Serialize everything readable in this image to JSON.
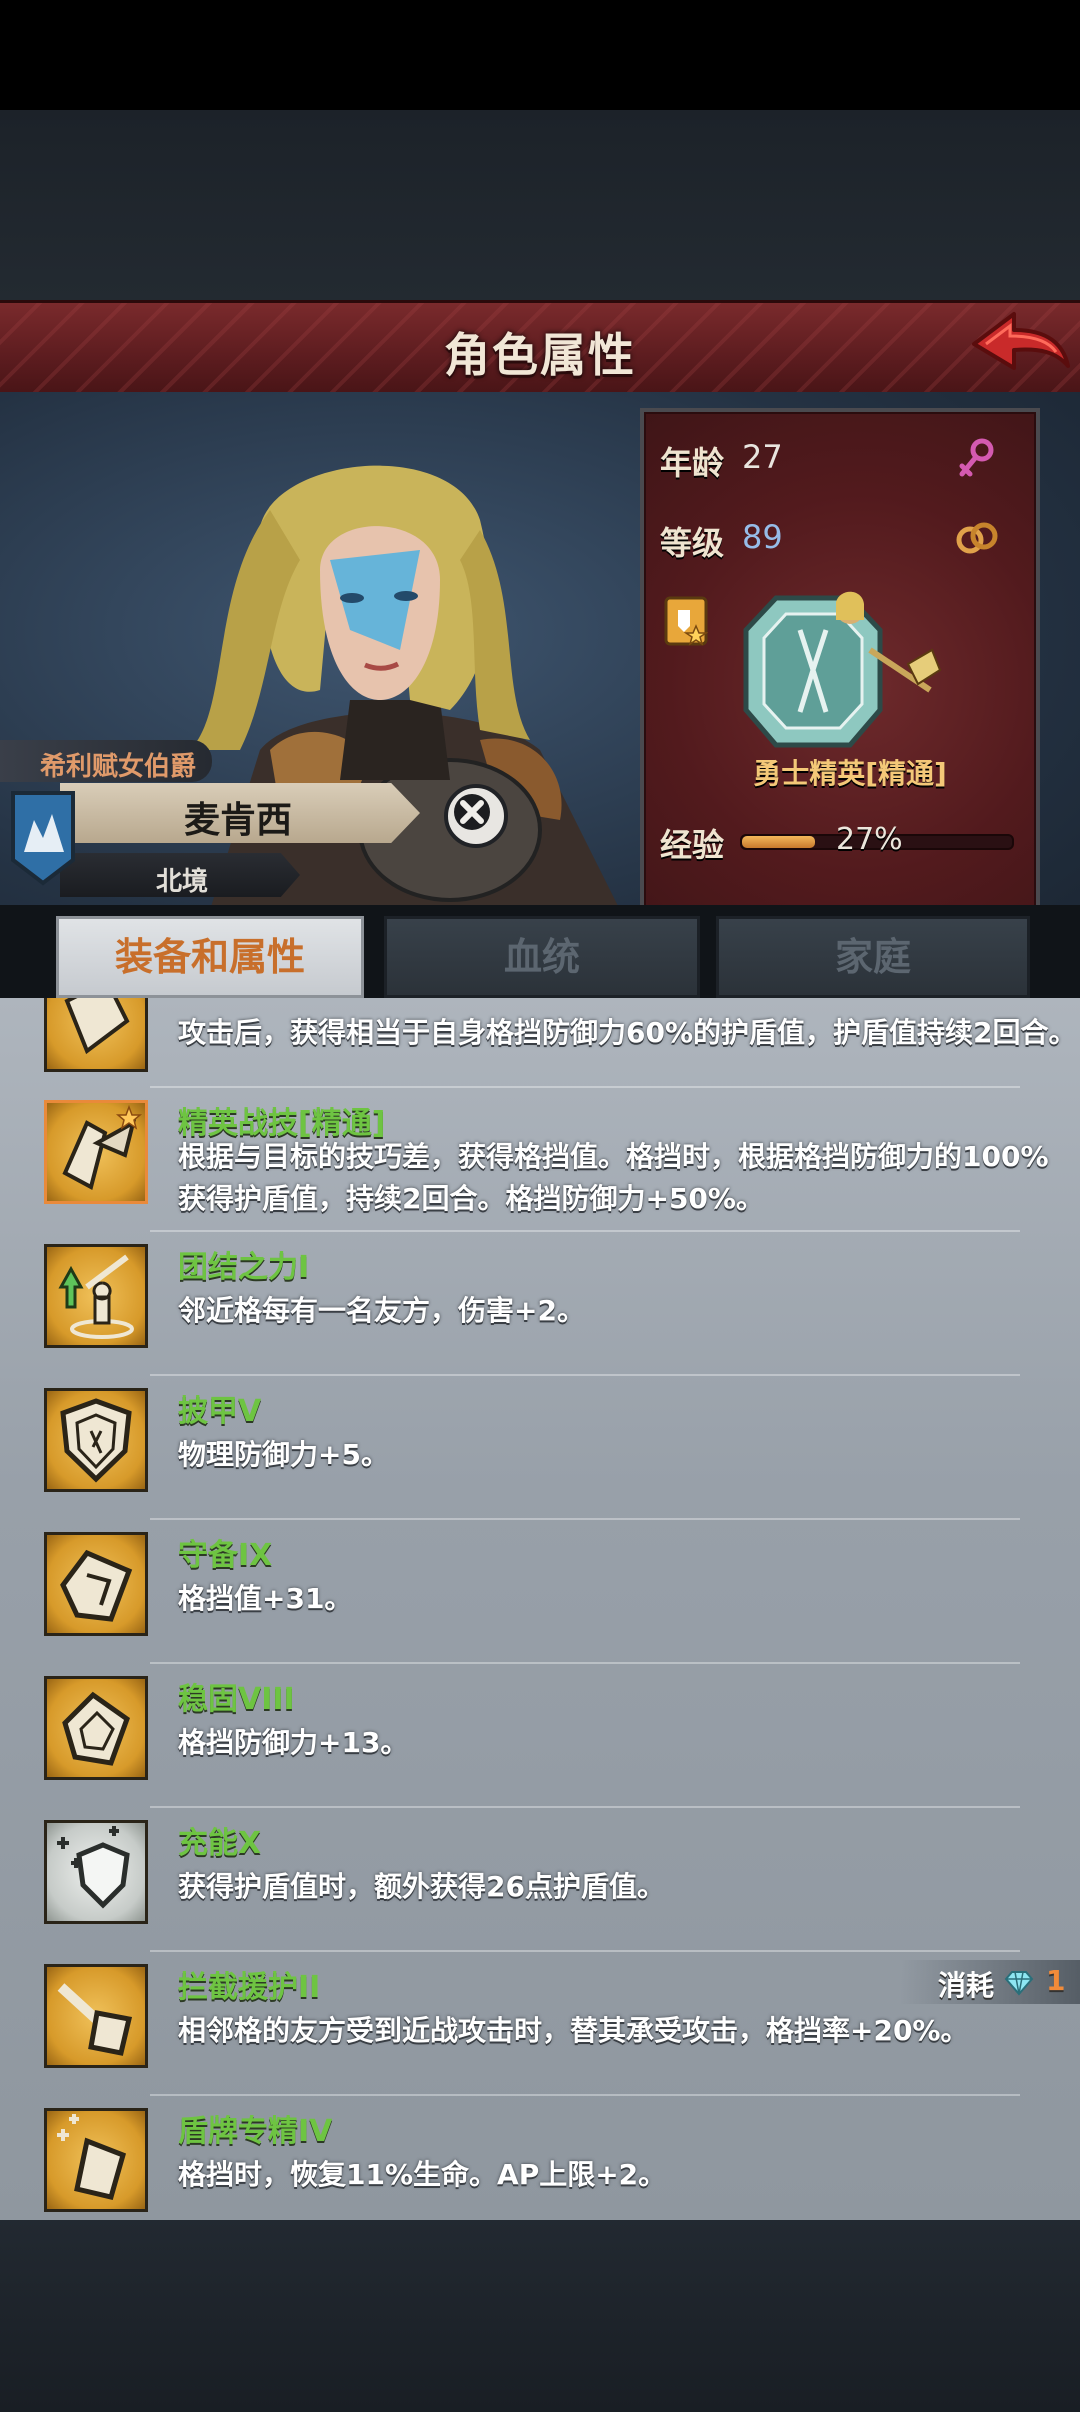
{
  "header": {
    "title": "角色属性"
  },
  "character": {
    "title": "希利赋女伯爵",
    "name": "麦肯西",
    "region": "北境"
  },
  "stats": {
    "age_label": "年龄",
    "age": "27",
    "level_label": "等级",
    "level": "89",
    "class_name": "勇士精英[精通]",
    "xp_label": "经验",
    "xp_percent": "27%",
    "xp_fraction": 0.27
  },
  "tabs": [
    {
      "label": "装备和属性",
      "active": true
    },
    {
      "label": "血统",
      "active": false
    },
    {
      "label": "家庭",
      "active": false
    }
  ],
  "skills": [
    {
      "name": "",
      "desc": [
        "攻击后，获得相当于自身格挡防御力60%的护盾值，护盾值持续2回合。"
      ],
      "icon": "shield-bash-icon"
    },
    {
      "name": "精英战技[精通]",
      "desc": [
        "根据与目标的技巧差，获得格挡值。格挡时，根据格挡防御力的100%",
        "获得护盾值，持续2回合。格挡防御力+50%。"
      ],
      "icon": "elite-technique-icon"
    },
    {
      "name": "团结之力I",
      "desc": [
        "邻近格每有一名友方，伤害+2。"
      ],
      "icon": "unity-power-icon"
    },
    {
      "name": "披甲V",
      "desc": [
        "物理防御力+5。"
      ],
      "icon": "armor-shield-icon"
    },
    {
      "name": "守备IX",
      "desc": [
        "格挡值+31。"
      ],
      "icon": "guard-icon"
    },
    {
      "name": "稳固VIII",
      "desc": [
        "格挡防御力+13。"
      ],
      "icon": "steady-icon"
    },
    {
      "name": "充能X",
      "desc": [
        "获得护盾值时，额外获得26点护盾值。"
      ],
      "icon": "charge-shield-icon"
    },
    {
      "name": "拦截援护II",
      "desc": [
        "相邻格的友方受到近战攻击时，替其承受攻击，格挡率+20%。"
      ],
      "icon": "intercept-icon",
      "cost_label": "消耗",
      "cost_value": "1"
    },
    {
      "name": "盾牌专精IV",
      "desc": [
        "格挡时，恢复11%生命。AP上限+2。"
      ],
      "icon": "shield-mastery-icon"
    }
  ],
  "colors": {
    "header": "#5c1c1f",
    "skill_name": "#6ec442",
    "active_tab_text": "#c86f2b",
    "cost_number": "#f18b3a",
    "level_value": "#96bce8"
  }
}
